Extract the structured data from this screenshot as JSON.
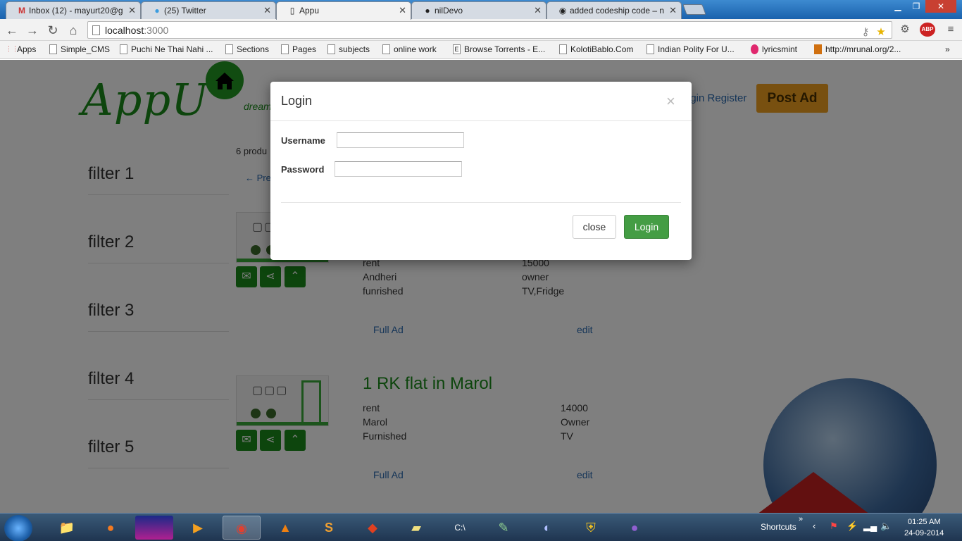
{
  "browser": {
    "tabs": [
      {
        "title": "Inbox (12) - mayurt20@g",
        "icon": "gmail-icon"
      },
      {
        "title": "(25) Twitter",
        "icon": "twitter-icon"
      },
      {
        "title": "Appu",
        "icon": "page-icon"
      },
      {
        "title": "nilDevo",
        "icon": "github-icon"
      },
      {
        "title": "added codeship code – n",
        "icon": "generic-site-icon"
      }
    ],
    "url_host": "localhost",
    "url_port": ":3000",
    "bookmarks": [
      "Apps",
      "Simple_CMS",
      "Puchi Ne Thai Nahi ...",
      "Sections",
      "Pages",
      "subjects",
      "online work",
      "Browse Torrents - E...",
      "KolotiBablo.Com",
      "Indian Polity For U...",
      "lyricsmint",
      "http://mrunal.org/2..."
    ],
    "abp_label": "ABP"
  },
  "site": {
    "logo_text": "AppU",
    "tagline": "dream",
    "auth_links": "ogin Register",
    "post_ad_label": "Post Ad",
    "filters": [
      "filter 1",
      "filter 2",
      "filter 3",
      "filter 4",
      "filter 5"
    ],
    "product_count": "6 produ",
    "prev_link": "← Pre",
    "listings": [
      {
        "title": "",
        "type": "rent",
        "price": "15000",
        "location": "Andheri",
        "owner": "owner",
        "furnishing": "funrished",
        "amenities": "TV,Fridge",
        "full_ad": "Full Ad",
        "edit": "edit"
      },
      {
        "title": "1 RK flat in Marol",
        "type": "rent",
        "price": "14000",
        "location": "Marol",
        "owner": "Owner",
        "furnishing": "Furnished",
        "amenities": "TV",
        "full_ad": "Full Ad",
        "edit": "edit"
      }
    ]
  },
  "modal": {
    "title": "Login",
    "close_x": "×",
    "username_label": "Username",
    "username_value": "",
    "password_label": "Password",
    "password_value": "",
    "close_label": "close",
    "login_label": "Login"
  },
  "taskbar": {
    "apps": [
      "explorer-icon",
      "firefox-icon",
      "media-icon",
      "player-icon",
      "chrome-icon",
      "vlc-icon",
      "sublime-icon",
      "git-icon",
      "notes-icon",
      "cmd-icon",
      "notepadpp-icon",
      "torrent-icon",
      "security-icon",
      "github-desktop-icon"
    ],
    "shortcuts_label": "Shortcuts",
    "time": "01:25 AM",
    "date": "24-09-2014"
  },
  "colors": {
    "brand_green": "#1a8a1a",
    "post_ad": "#f0a020",
    "login_button": "#449d44",
    "link": "#2a6ab0"
  }
}
